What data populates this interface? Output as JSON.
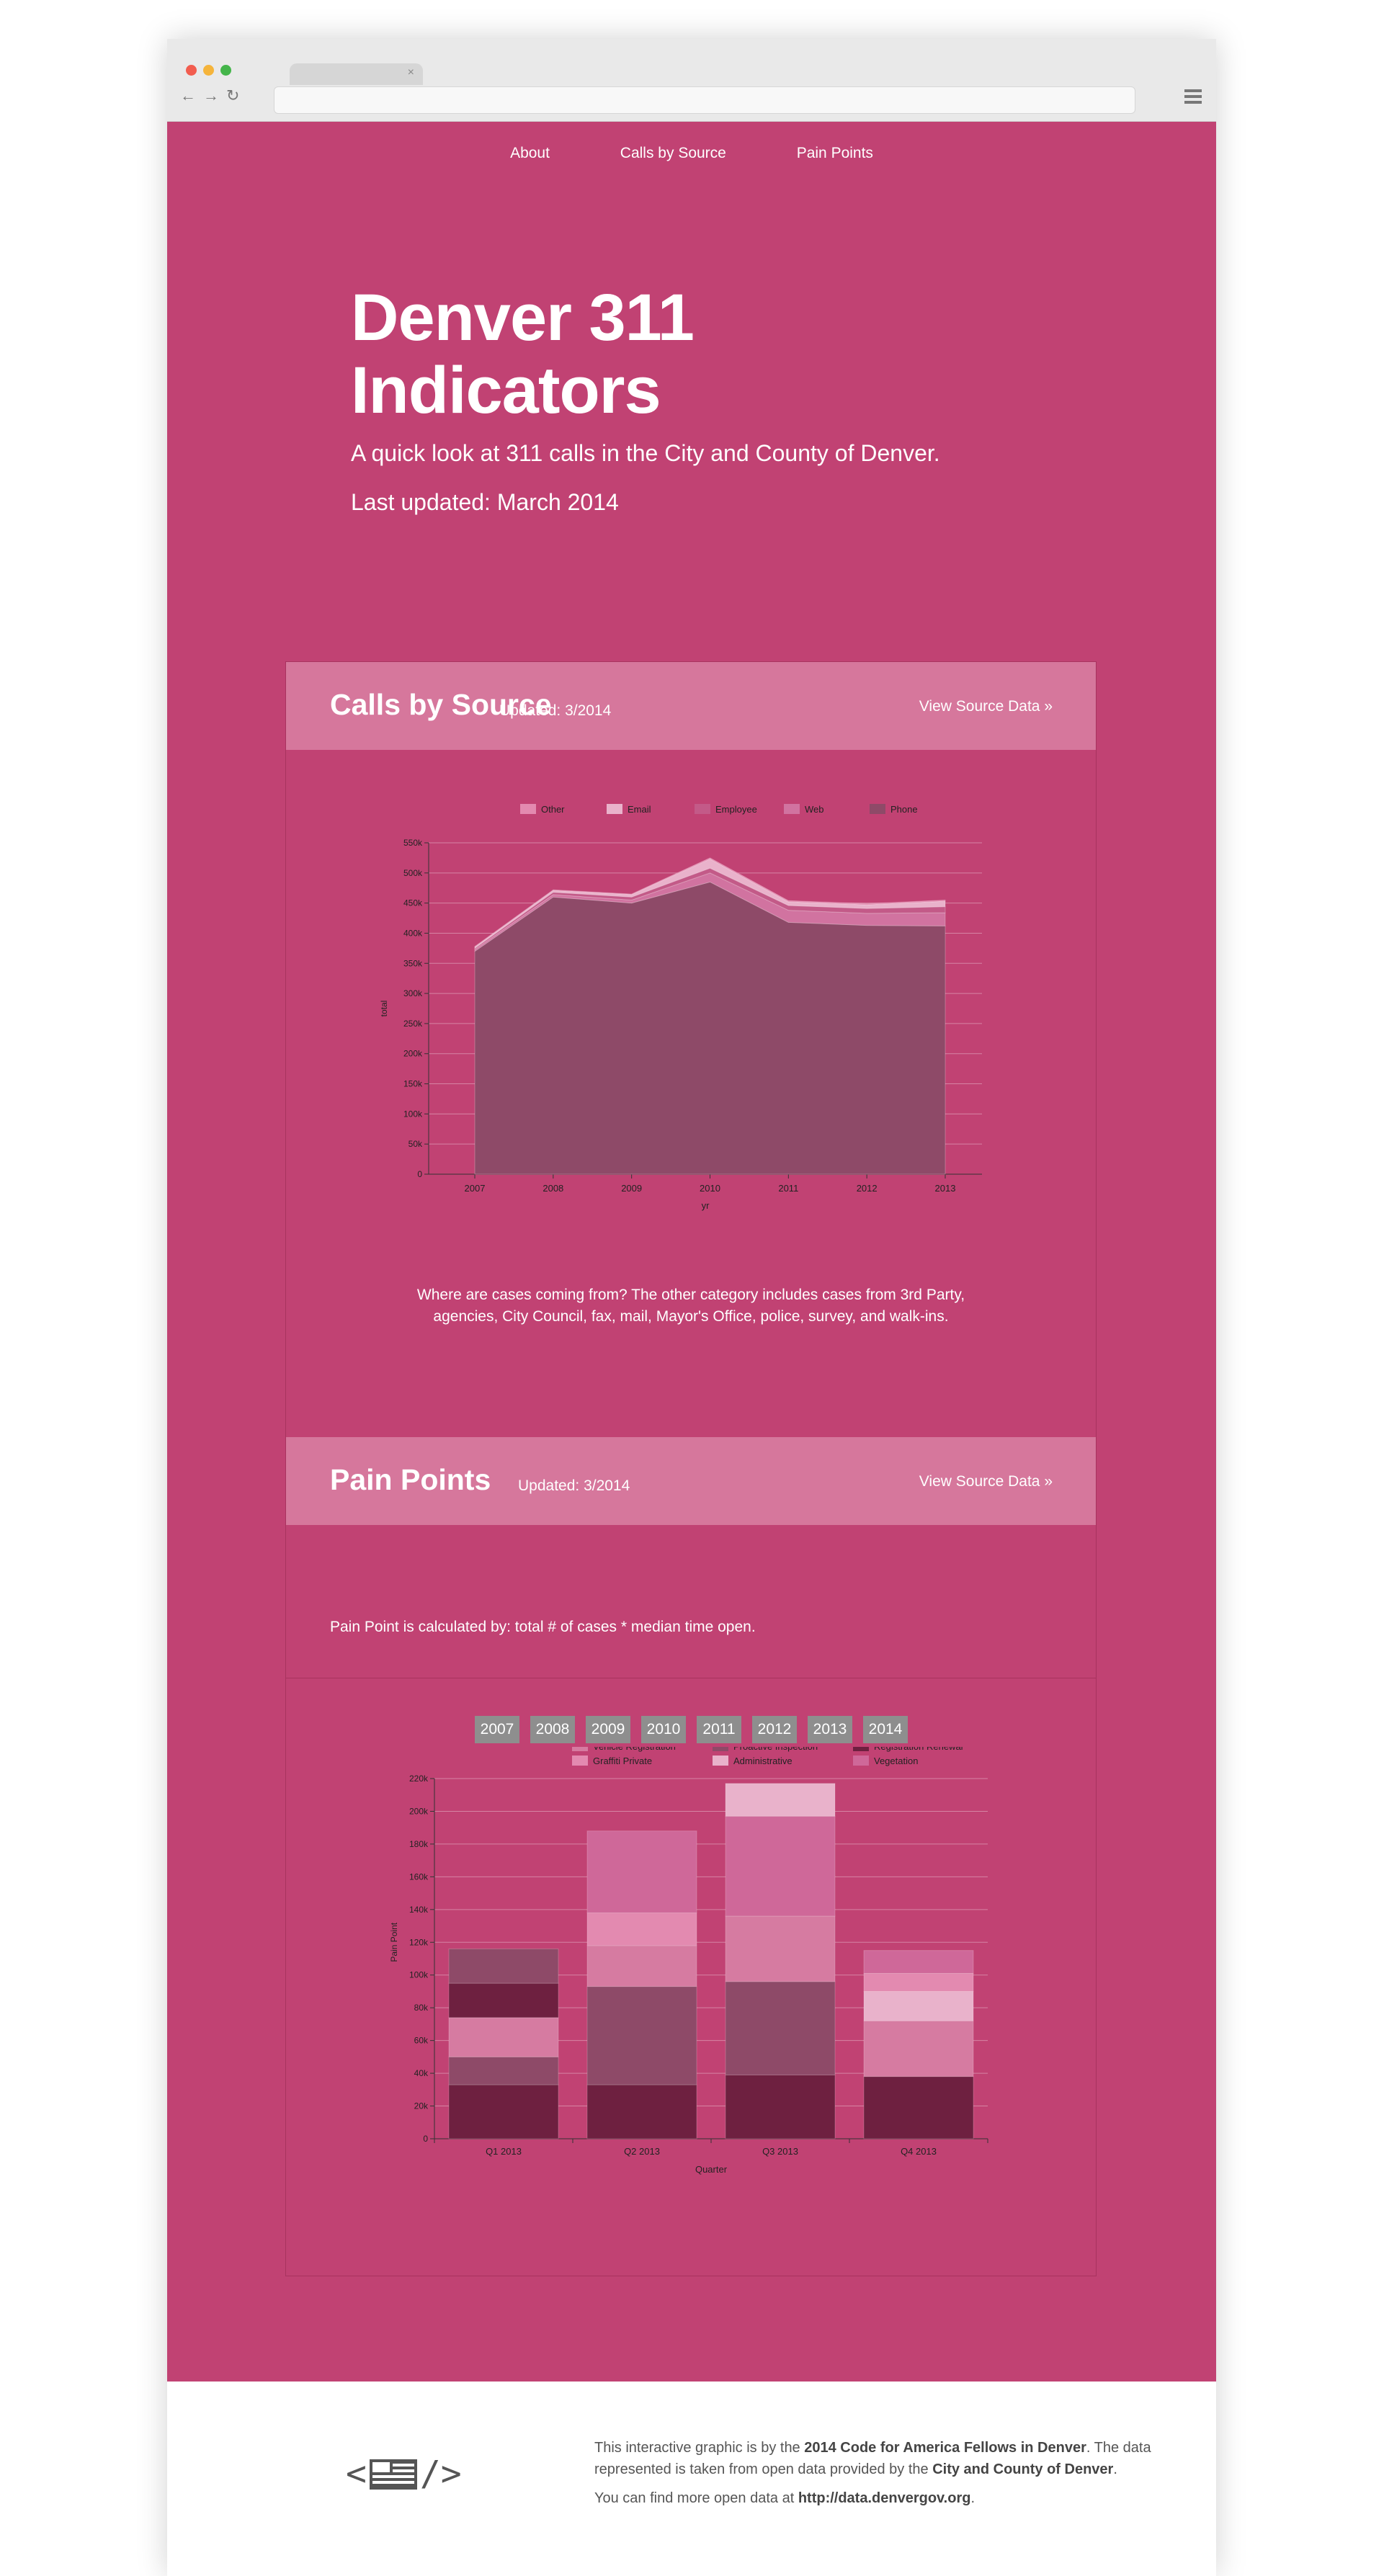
{
  "nav": {
    "about": "About",
    "calls": "Calls by Source",
    "pain": "Pain Points"
  },
  "hero": {
    "title_line1": "Denver 311",
    "title_line2": "Indicators",
    "subtitle": "A quick look at 311 calls in the City and County of Denver.",
    "updated": "Last updated: March 2014"
  },
  "calls_panel": {
    "title": "Calls by Source",
    "updated": "Updated: 3/2014",
    "view_link": "View Source Data »",
    "caption_line1": "Where are cases coming from? The other category includes cases from 3rd Party,",
    "caption_line2": "agencies, City Council, fax, mail, Mayor's Office, police, survey, and walk-ins."
  },
  "pain_panel": {
    "title": "Pain Points",
    "updated": "Updated: 3/2014",
    "view_link": "View Source Data »",
    "calc": "Pain Point is calculated by: total # of cases * median time open.",
    "years": [
      "2007",
      "2008",
      "2009",
      "2010",
      "2011",
      "2012",
      "2013",
      "2014"
    ]
  },
  "footer": {
    "credit_pre": "This interactive graphic is by the ",
    "credit_bold": "2014 Code for America Fellows in Denver",
    "credit_mid": ". The data represented is taken from open data provided by the ",
    "credit_bold2": "City and County of Denver",
    "credit_end": ".",
    "more_pre": "You can find more open data at ",
    "more_link": "http://data.denvergov.org",
    "more_end": "."
  },
  "chart_data": [
    {
      "type": "area",
      "xlabel": "yr",
      "ylabel": "total",
      "x": [
        "2007",
        "2008",
        "2009",
        "2010",
        "2011",
        "2012",
        "2013"
      ],
      "ylim": [
        0,
        550000
      ],
      "yticks": [
        "0",
        "50k",
        "100k",
        "150k",
        "200k",
        "250k",
        "300k",
        "350k",
        "400k",
        "450k",
        "500k",
        "550k"
      ],
      "legend_position": "top",
      "series": [
        {
          "name": "Phone",
          "color": "#8e4a68",
          "values": [
            370000,
            460000,
            450000,
            485000,
            418000,
            413000,
            412000
          ]
        },
        {
          "name": "Web",
          "color": "#d173a0",
          "values": [
            3000,
            4000,
            5000,
            15000,
            20000,
            20000,
            22000
          ]
        },
        {
          "name": "Employee",
          "color": "#c35a88",
          "values": [
            2000,
            4000,
            5000,
            8000,
            8000,
            8000,
            10000
          ]
        },
        {
          "name": "Email",
          "color": "#e9b2cb",
          "values": [
            2000,
            3000,
            4000,
            15000,
            6000,
            6000,
            9000
          ]
        },
        {
          "name": "Other",
          "color": "#e38ab0",
          "values": [
            1000,
            1000,
            1000,
            2000,
            2000,
            2000,
            2000
          ]
        }
      ]
    },
    {
      "type": "bar",
      "stacked": true,
      "xlabel": "Quarter",
      "ylabel": "Pain Point",
      "categories": [
        "Q1 2013",
        "Q2 2013",
        "Q3 2013",
        "Q4 2013"
      ],
      "ylim": [
        0,
        220000
      ],
      "yticks": [
        "0",
        "20k",
        "40k",
        "60k",
        "80k",
        "100k",
        "120k",
        "140k",
        "160k",
        "180k",
        "200k",
        "220k"
      ],
      "legend_position": "top",
      "series": [
        {
          "name": "Registration Renewal",
          "color": "#6e2040",
          "values": [
            33000,
            33000,
            39000,
            38000
          ]
        },
        {
          "name": "Proactive Inspection",
          "color": "#8e4a68",
          "values": [
            17000,
            60000,
            57000,
            0
          ]
        },
        {
          "name": "Vehicle Registration",
          "color": "#d67ba1",
          "values": [
            24000,
            25000,
            40000,
            34000
          ]
        },
        {
          "name": "Administrative",
          "color": "#e9b2cb",
          "values": [
            0,
            0,
            0,
            18000
          ]
        },
        {
          "name": "Graffiti Private",
          "color": "#e38ab0",
          "values": [
            0,
            20000,
            0,
            11000
          ]
        },
        {
          "name": "Vegetation",
          "color": "#cf6899",
          "values": [
            0,
            50000,
            61000,
            14000
          ]
        },
        {
          "name": "Registration Renewal",
          "color": "#6e2040",
          "values": [
            21000,
            0,
            0,
            0
          ]
        },
        {
          "name": "Proactive Inspection",
          "color": "#8e4a68",
          "values": [
            21000,
            0,
            0,
            0
          ]
        },
        {
          "name": "Administrative",
          "color": "#e9b2cb",
          "values": [
            0,
            0,
            20000,
            0
          ]
        }
      ]
    }
  ]
}
